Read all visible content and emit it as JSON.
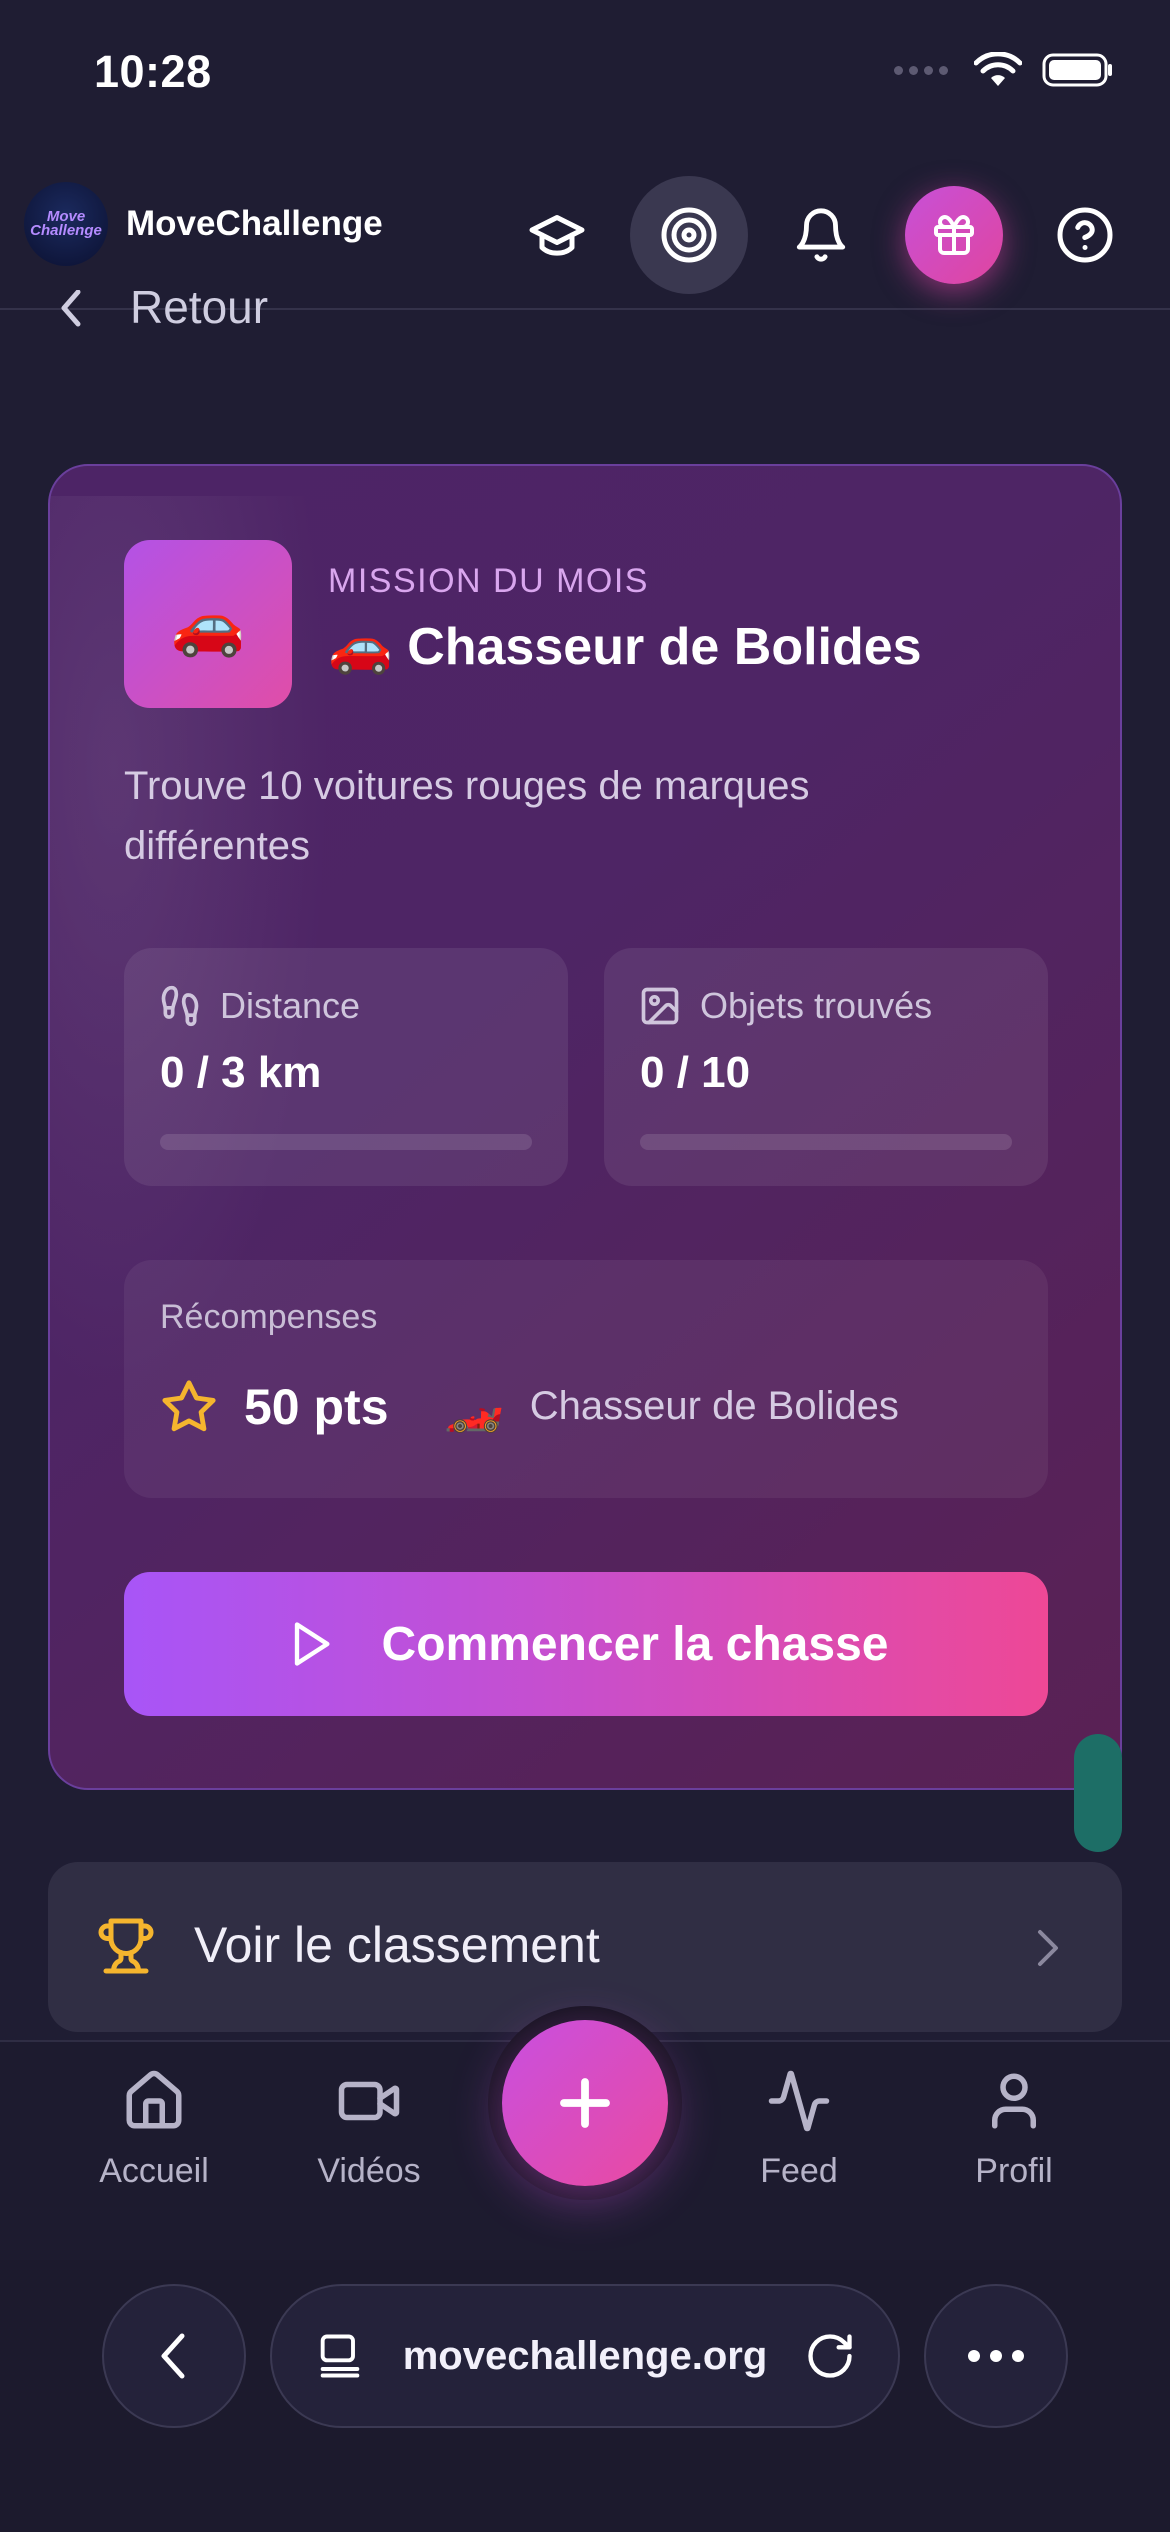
{
  "status_bar": {
    "time": "10:28"
  },
  "header": {
    "logo_text_line1": "Move",
    "logo_text_line2": "Challenge",
    "app_name": "MoveChallenge",
    "icons": [
      "graduation-cap-icon",
      "target-icon",
      "bell-icon",
      "gift-icon",
      "help-icon"
    ],
    "active_icon": "target-icon"
  },
  "back": {
    "label": "Retour"
  },
  "mission": {
    "icon_emoji": "🚗",
    "kicker": "MISSION DU MOIS",
    "title": "🚗 Chasseur de Bolides",
    "description": "Trouve 10 voitures rouges de marques différentes",
    "stats": [
      {
        "icon": "footprints-icon",
        "label": "Distance",
        "value": "0 / 3 km",
        "progress": 0
      },
      {
        "icon": "image-icon",
        "label": "Objets trouvés",
        "value": "0 / 10",
        "progress": 0
      }
    ],
    "rewards": {
      "label": "Récompenses",
      "points": "50 pts",
      "badge_emoji": "🏎️",
      "badge_name": "Chasseur de Bolides"
    },
    "start_button": "Commencer la chasse"
  },
  "leaderboard": {
    "label": "Voir le classement"
  },
  "bottom_nav": {
    "items": [
      {
        "label": "Accueil",
        "icon": "home-icon"
      },
      {
        "label": "Vidéos",
        "icon": "video-icon"
      },
      {
        "label": "Feed",
        "icon": "activity-icon"
      },
      {
        "label": "Profil",
        "icon": "user-icon"
      }
    ],
    "fab_icon": "plus-icon"
  },
  "browser": {
    "url": "movechallenge.org"
  },
  "colors": {
    "background": "#1f1d33",
    "accent_purple": "#a855f7",
    "accent_pink": "#ee4896",
    "star": "#f5b52e"
  }
}
